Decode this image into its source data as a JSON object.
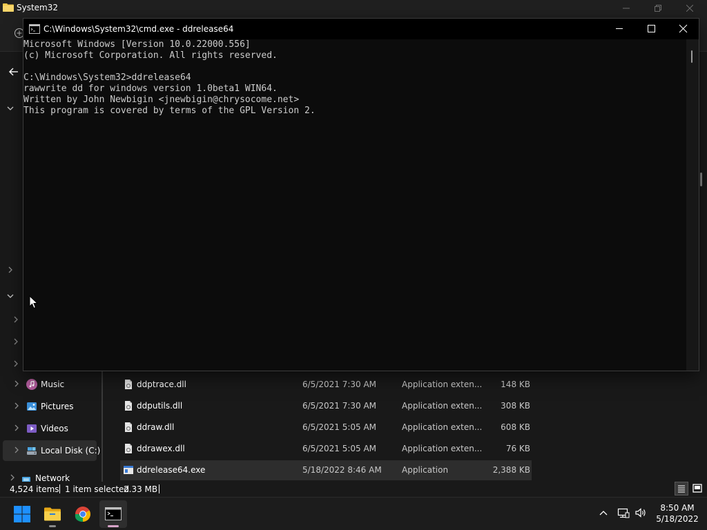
{
  "explorer": {
    "title": "System32",
    "nav": [
      {
        "label": "Music",
        "icon": "music-icon"
      },
      {
        "label": "Pictures",
        "icon": "pictures-icon"
      },
      {
        "label": "Videos",
        "icon": "videos-icon"
      },
      {
        "label": "Local Disk (C:)",
        "icon": "drive-icon",
        "selected": true
      },
      {
        "label": "Network",
        "icon": "network-icon"
      }
    ],
    "files": [
      {
        "name": "ddptrace.dll",
        "date": "6/5/2021 7:30 AM",
        "type": "Application exten...",
        "size": "148 KB",
        "icon": "dll-file-icon"
      },
      {
        "name": "ddputils.dll",
        "date": "6/5/2021 7:30 AM",
        "type": "Application exten...",
        "size": "308 KB",
        "icon": "dll-file-icon"
      },
      {
        "name": "ddraw.dll",
        "date": "6/5/2021 5:05 AM",
        "type": "Application exten...",
        "size": "608 KB",
        "icon": "dll-file-icon"
      },
      {
        "name": "ddrawex.dll",
        "date": "6/5/2021 5:05 AM",
        "type": "Application exten...",
        "size": "76 KB",
        "icon": "dll-file-icon"
      },
      {
        "name": "ddrelease64.exe",
        "date": "5/18/2022 8:46 AM",
        "type": "Application",
        "size": "2,388 KB",
        "icon": "exe-file-icon",
        "selected": true
      }
    ],
    "status": {
      "item_count": "4,524 items",
      "selected": "1 item selected",
      "selected_size": "2.33 MB"
    }
  },
  "cmd": {
    "title": "C:\\Windows\\System32\\cmd.exe - ddrelease64",
    "lines": [
      "Microsoft Windows [Version 10.0.22000.556]",
      "(c) Microsoft Corporation. All rights reserved.",
      "",
      "C:\\Windows\\System32>ddrelease64",
      "rawwrite dd for windows version 1.0beta1 WIN64.",
      "Written by John Newbigin <jnewbigin@chrysocome.net>",
      "This program is covered by terms of the GPL Version 2."
    ]
  },
  "taskbar": {
    "apps": [
      {
        "name": "start-button",
        "icon": "windows-logo-icon"
      },
      {
        "name": "file-explorer-taskbar-button",
        "icon": "folder-icon"
      },
      {
        "name": "chrome-taskbar-button",
        "icon": "chrome-icon"
      },
      {
        "name": "cmd-taskbar-button",
        "icon": "terminal-icon",
        "active": true
      }
    ],
    "time": "8:50 AM",
    "date": "5/18/2022"
  },
  "colors": {
    "accent": "#d8a4c9",
    "folder": "#f2c94c",
    "windows_blue": "#1e90ff"
  }
}
